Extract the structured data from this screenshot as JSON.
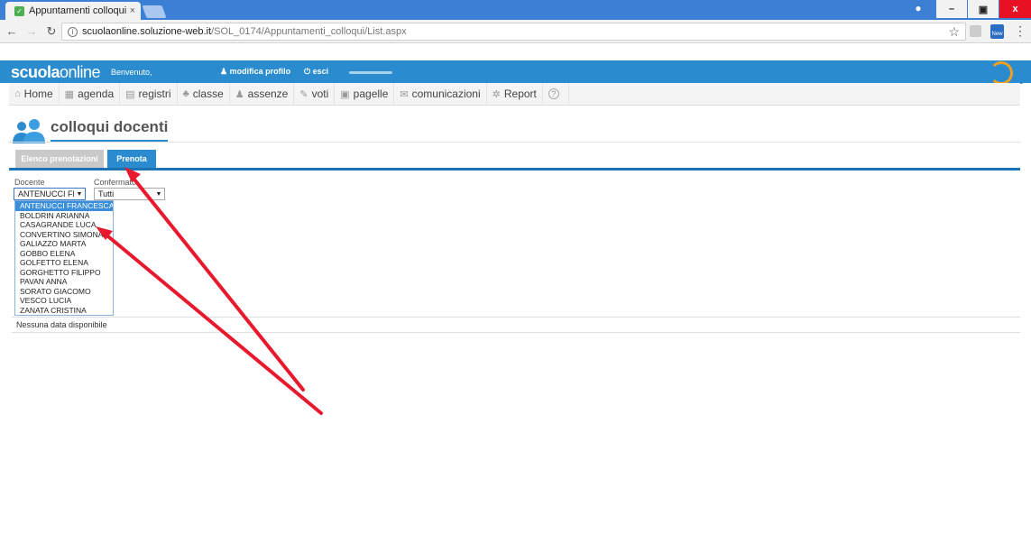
{
  "browser": {
    "tab_title": "Appuntamenti colloqui",
    "tab_close": "×",
    "url_host": "scuolaonline.soluzione-web.it",
    "url_path": "/SOL_0174/Appuntamenti_colloqui/List.aspx",
    "ext_badge": "New",
    "win_min": "–",
    "win_max": "▣",
    "win_close": "x"
  },
  "header": {
    "logo_bold": "scuola",
    "logo_light": "online",
    "welcome": "Benvenuto,",
    "edit_profile": "modifica profilo",
    "logout": "esci",
    "brand": "astori"
  },
  "menu": {
    "items": [
      {
        "label": "Home",
        "icon": "home-icon"
      },
      {
        "label": "agenda",
        "icon": "calendar-icon"
      },
      {
        "label": "registri",
        "icon": "book-icon"
      },
      {
        "label": "classe",
        "icon": "users-icon"
      },
      {
        "label": "assenze",
        "icon": "user-icon"
      },
      {
        "label": "voti",
        "icon": "edit-icon"
      },
      {
        "label": "pagelle",
        "icon": "report-card-icon"
      },
      {
        "label": "comunicazioni",
        "icon": "mail-icon"
      },
      {
        "label": "Report",
        "icon": "gear-icon"
      }
    ],
    "help": "?"
  },
  "page": {
    "title": "colloqui docenti",
    "tabs": [
      "Elenco prenotazioni",
      "Prenota"
    ],
    "active_tab": "Prenota"
  },
  "filters": {
    "docente_label": "Docente",
    "docente_value": "ANTENUCCI FF",
    "confermato_label": "Confermato",
    "confermato_value": "Tutti"
  },
  "dropdown": {
    "options": [
      "ANTENUCCI FRANCESCA",
      "BOLDRIN ARIANNA",
      "CASAGRANDE LUCA",
      "CONVERTINO SIMONA",
      "GALIAZZO MARTA",
      "GOBBO ELENA",
      "GOLFETTO ELENA",
      "GORGHETTO FILIPPO",
      "PAVAN ANNA",
      "SORATO GIACOMO",
      "VESCO LUCIA",
      "ZANATA CRISTINA"
    ],
    "selected": "ANTENUCCI FRANCESCA"
  },
  "results": {
    "empty_message": "Nessuna data disponibile"
  },
  "colors": {
    "accent": "#2a8ccf",
    "annotation": "#e8192c"
  }
}
